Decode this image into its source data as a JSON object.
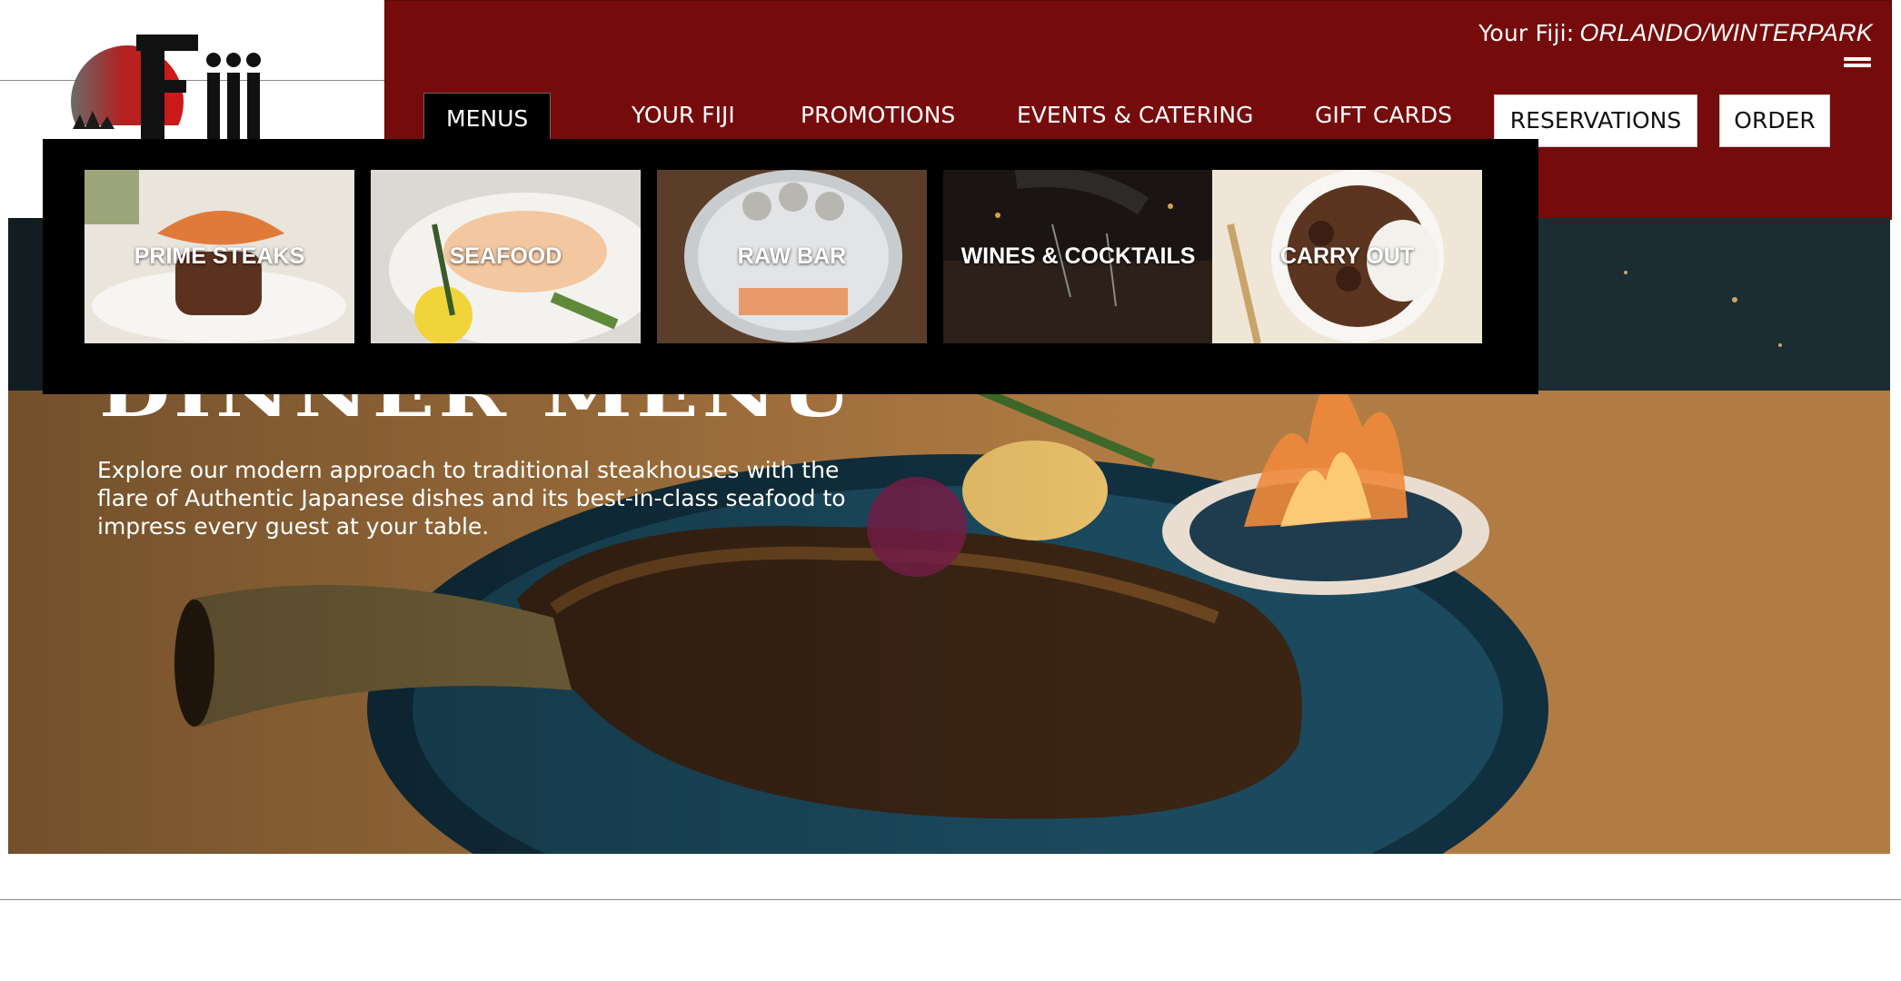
{
  "brand": {
    "logo_text": "Fiji"
  },
  "location": {
    "prefix": "Your Fiji:",
    "city": "ORLANDO/WINTERPARK"
  },
  "nav": {
    "menus": "MENUS",
    "your_fiji": "YOUR FIJI",
    "promotions": "PROMOTIONS",
    "events": "EVENTS & CATERING",
    "gift_cards": "GIFT CARDS",
    "reservations": "RESERVATIONS",
    "order": "ORDER"
  },
  "dropdown": {
    "tiles": [
      {
        "label": "PRIME STEAKS",
        "icon": "steak-photo"
      },
      {
        "label": "SEAFOOD",
        "icon": "lobster-photo"
      },
      {
        "label": "RAW BAR",
        "icon": "oysters-photo"
      },
      {
        "label": "WINES & COCKTAILS",
        "icon": "wine-photo"
      },
      {
        "label": "CARRY OUT",
        "icon": "bowl-photo"
      }
    ]
  },
  "hero": {
    "title": "DINNER MENU",
    "text": "Explore our modern approach to traditional steakhouses with the flare of Authentic Japanese dishes and its best-in-class seafood to impress every guest at your table."
  },
  "colors": {
    "header_bg": "#760b0b",
    "dropdown_bg": "#000000"
  }
}
